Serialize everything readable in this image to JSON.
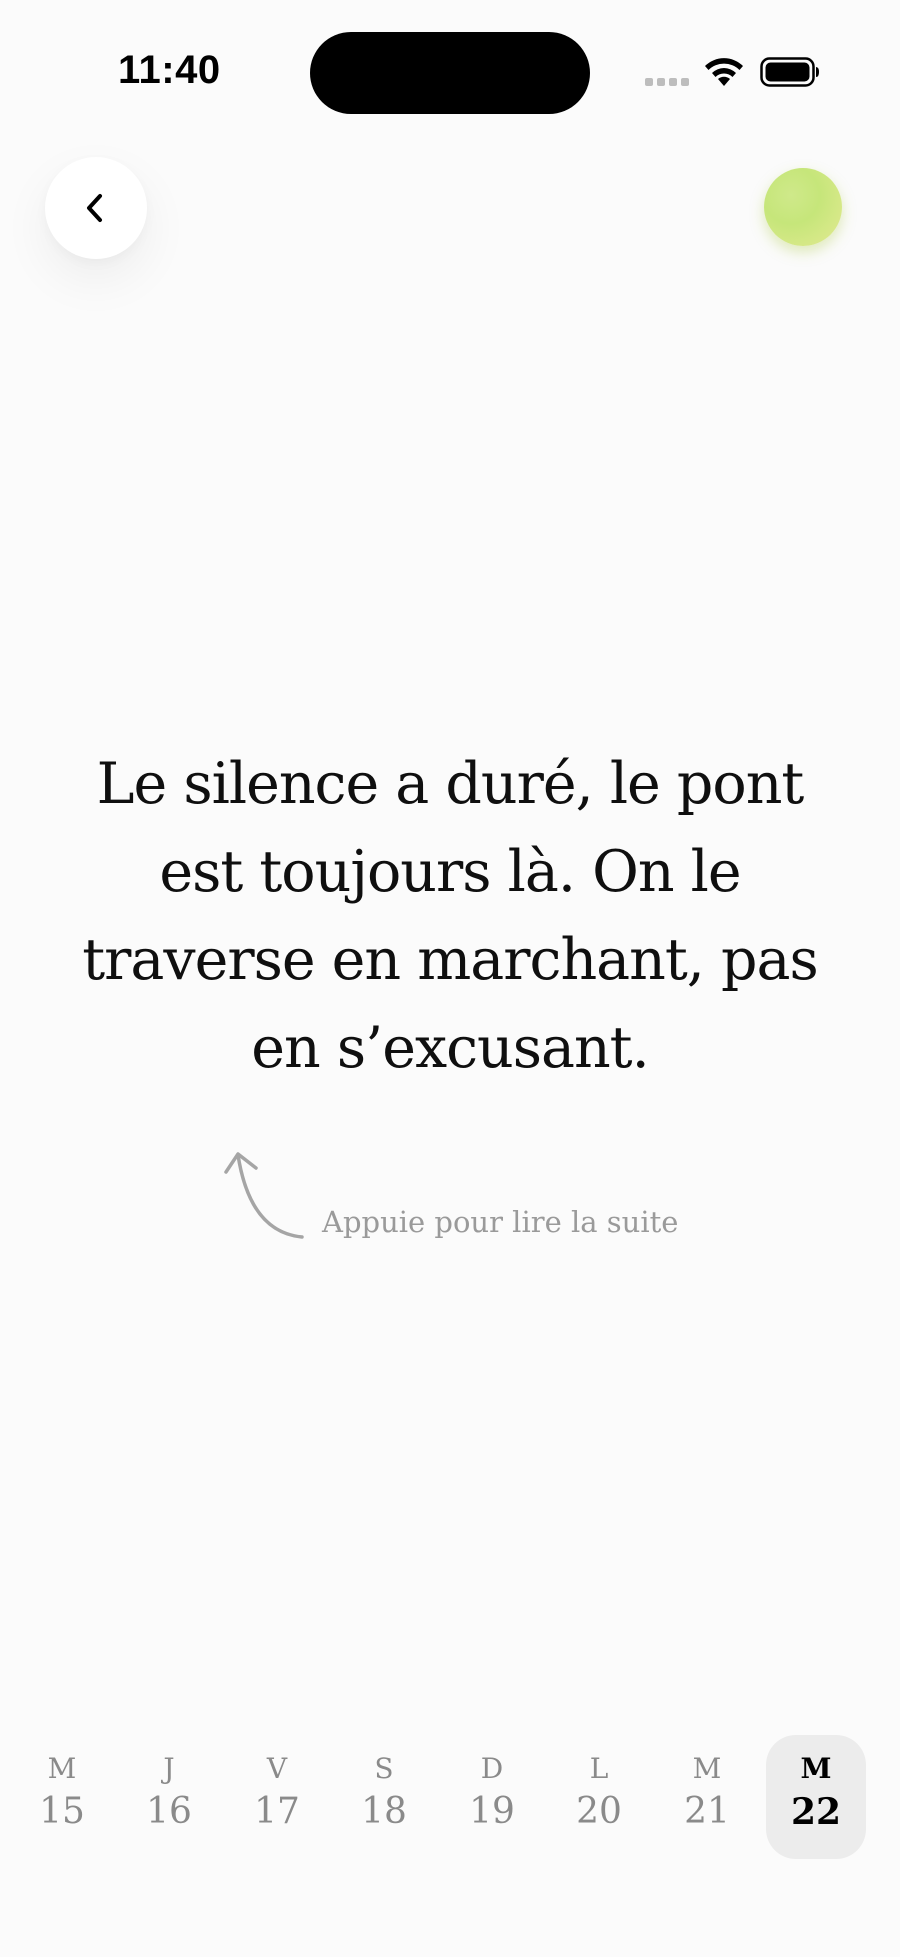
{
  "status_bar": {
    "time": "11:40"
  },
  "header": {
    "back_icon": "chevron-left-icon",
    "avatar_color": "#cfe98a"
  },
  "quote": {
    "text": "Le silence a duré, le pont est toujours là. On le traverse en marchant, pas en s’excusant."
  },
  "hint": {
    "icon": "curved-arrow-up-icon",
    "text": "Appuie pour lire la suite"
  },
  "days": [
    {
      "letter": "M",
      "number": "15",
      "selected": false
    },
    {
      "letter": "J",
      "number": "16",
      "selected": false
    },
    {
      "letter": "V",
      "number": "17",
      "selected": false
    },
    {
      "letter": "S",
      "number": "18",
      "selected": false
    },
    {
      "letter": "D",
      "number": "19",
      "selected": false
    },
    {
      "letter": "L",
      "number": "20",
      "selected": false
    },
    {
      "letter": "M",
      "number": "21",
      "selected": false
    },
    {
      "letter": "M",
      "number": "22",
      "selected": true
    }
  ]
}
